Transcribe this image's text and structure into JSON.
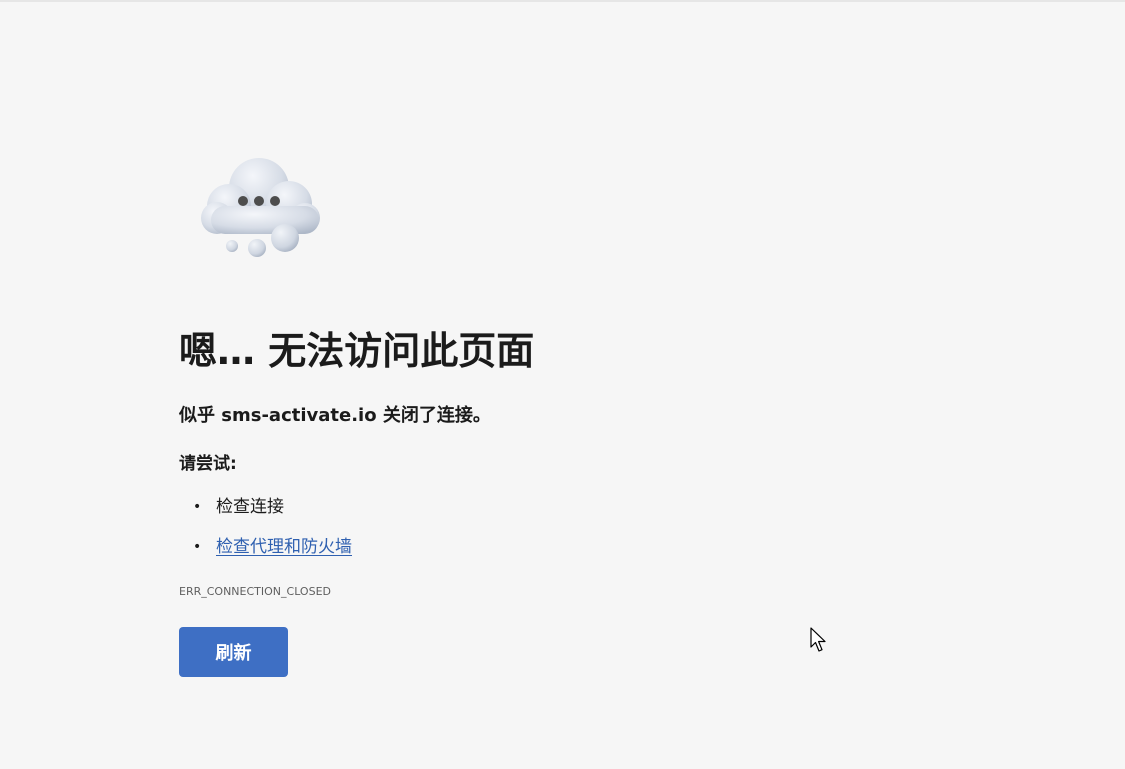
{
  "page": {
    "headline": "嗯… 无法访问此页面",
    "subheadline": "似乎 sms-activate.io 关闭了连接。",
    "try_label": "请尝试:",
    "suggestions": [
      {
        "text": "检查连接",
        "is_link": false
      },
      {
        "text": "检查代理和防火墙",
        "is_link": true
      }
    ],
    "bullet": "•",
    "error_code": "ERR_CONNECTION_CLOSED",
    "refresh_label": "刷新"
  },
  "icons": {
    "illustration": "cloud-thinking-icon",
    "cursor": "mouse-pointer-icon"
  },
  "colors": {
    "background": "#f6f6f6",
    "link": "#2f60b0",
    "button": "#3e6fc4",
    "text": "#1b1b1b",
    "error_code": "#5f5f5f"
  }
}
